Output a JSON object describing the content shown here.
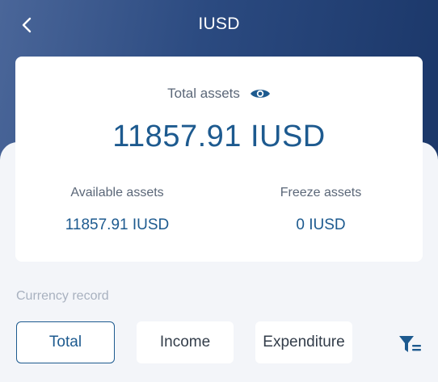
{
  "header": {
    "title": "IUSD",
    "back_icon": "chevron-left-icon"
  },
  "assets": {
    "total_label": "Total assets",
    "visibility_icon": "eye-icon",
    "total_value": "11857.91 IUSD",
    "available_label": "Available assets",
    "available_value": "11857.91 IUSD",
    "freeze_label": "Freeze assets",
    "freeze_value": "0 IUSD"
  },
  "record": {
    "section_label": "Currency record",
    "tabs": [
      {
        "label": "Total",
        "active": true
      },
      {
        "label": "Income",
        "active": false
      },
      {
        "label": "Expenditure",
        "active": false
      }
    ],
    "filter_icon": "filter-icon"
  },
  "colors": {
    "accent": "#1d5a8f",
    "header_start": "#4a6699",
    "header_end": "#1b3769"
  }
}
